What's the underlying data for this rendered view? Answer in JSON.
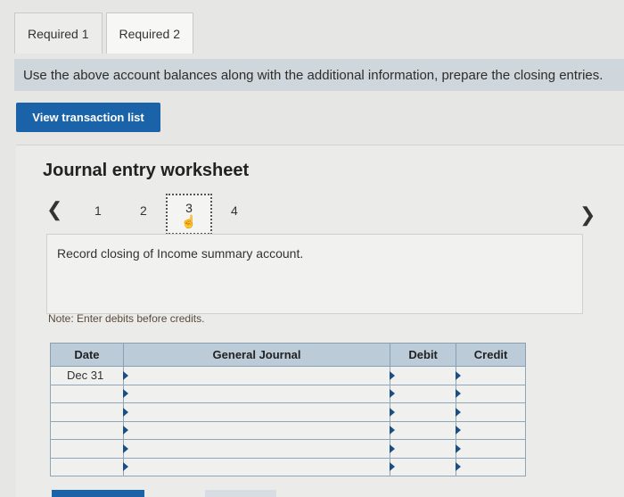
{
  "tabs": [
    {
      "label": "Required 1"
    },
    {
      "label": "Required 2"
    }
  ],
  "banner": {
    "text": "Use the above account balances along with the additional information, prepare the closing entries."
  },
  "view_transaction_button": {
    "label": "View transaction list"
  },
  "worksheet": {
    "title": "Journal entry worksheet",
    "steps": [
      "1",
      "2",
      "3",
      "4"
    ],
    "active_step": "3",
    "instruction": "Record closing of Income summary account.",
    "note": "Note: Enter debits before credits."
  },
  "journal": {
    "headers": {
      "date": "Date",
      "general_journal": "General Journal",
      "debit": "Debit",
      "credit": "Credit"
    },
    "rows": [
      {
        "date": "Dec 31",
        "general_journal": "",
        "debit": "",
        "credit": ""
      },
      {
        "date": "",
        "general_journal": "",
        "debit": "",
        "credit": ""
      },
      {
        "date": "",
        "general_journal": "",
        "debit": "",
        "credit": ""
      },
      {
        "date": "",
        "general_journal": "",
        "debit": "",
        "credit": ""
      },
      {
        "date": "",
        "general_journal": "",
        "debit": "",
        "credit": ""
      },
      {
        "date": "",
        "general_journal": "",
        "debit": "",
        "credit": ""
      }
    ]
  },
  "colors": {
    "accent": "#1a63a8",
    "banner_bg": "#cfd6dc",
    "table_header": "#bccbd8"
  },
  "icons": {
    "prev": "chevron-left-icon",
    "next": "chevron-right-icon",
    "cursor": "hand-pointer-icon"
  }
}
